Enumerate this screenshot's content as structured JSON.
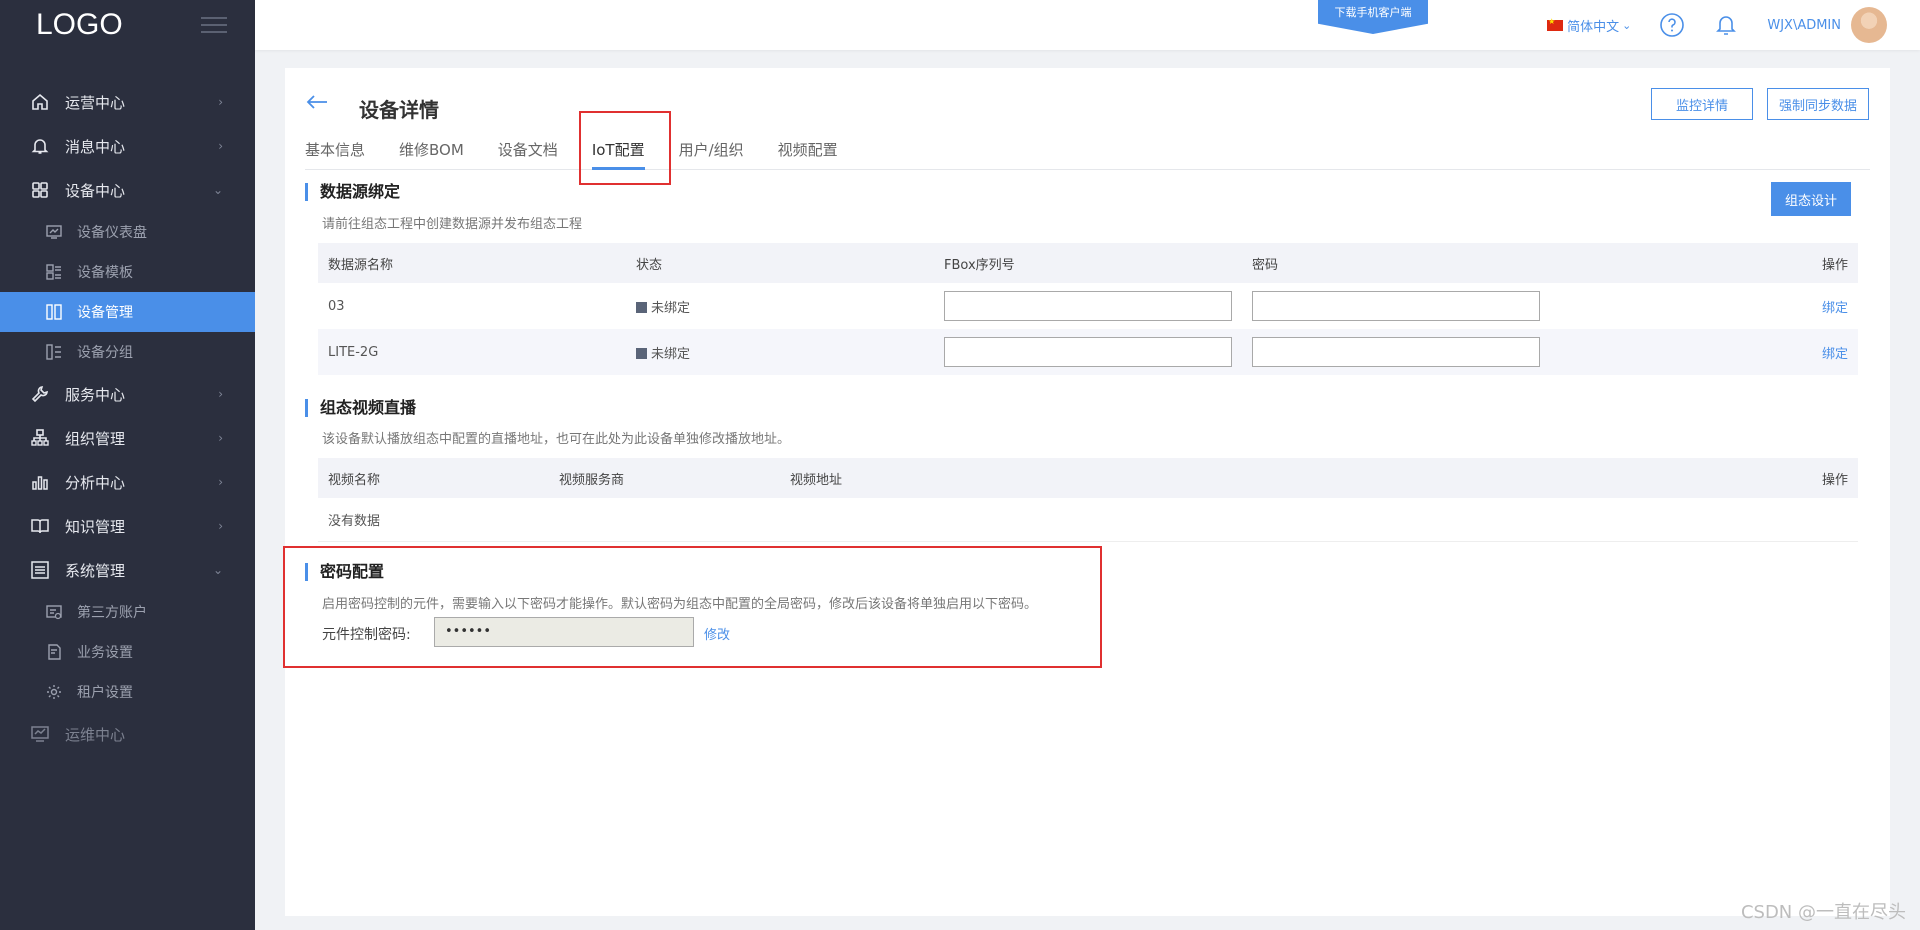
{
  "sidebar": {
    "logo": "LOGO",
    "items": [
      {
        "label": "运营中心",
        "arrow": "›"
      },
      {
        "label": "消息中心",
        "arrow": "›"
      },
      {
        "label": "设备中心",
        "arrow": "⌄"
      },
      {
        "label": "服务中心",
        "arrow": "›"
      },
      {
        "label": "组织管理",
        "arrow": "›"
      },
      {
        "label": "分析中心",
        "arrow": "›"
      },
      {
        "label": "知识管理",
        "arrow": "›"
      },
      {
        "label": "系统管理",
        "arrow": "⌄"
      },
      {
        "label": "运维中心"
      }
    ],
    "device_sub": [
      "设备仪表盘",
      "设备模板",
      "设备管理",
      "设备分组"
    ],
    "system_sub": [
      "第三方账户",
      "业务设置",
      "租户设置"
    ]
  },
  "header": {
    "download": "下载手机客户端",
    "language": "简体中文",
    "lang_arrow": "⌄",
    "username": "WJX\\ADMIN"
  },
  "page": {
    "title": "设备详情",
    "btn_monitor": "监控详情",
    "btn_sync": "强制同步数据",
    "tabs": [
      "基本信息",
      "维修BOM",
      "设备文档",
      "IoT配置",
      "用户/组织",
      "视频配置"
    ]
  },
  "datasource": {
    "title": "数据源绑定",
    "desc": "请前往组态工程中创建数据源并发布组态工程",
    "btn_design": "组态设计",
    "headers": [
      "数据源名称",
      "状态",
      "FBox序列号",
      "密码",
      "操作"
    ],
    "rows": [
      {
        "name": "03",
        "status": "未绑定",
        "fbox": "",
        "password": "",
        "action": "绑定"
      },
      {
        "name": "LITE-2G",
        "status": "未绑定",
        "fbox": "",
        "password": "",
        "action": "绑定"
      }
    ]
  },
  "video": {
    "title": "组态视频直播",
    "desc": "该设备默认播放组态中配置的直播地址，也可在此处为此设备单独修改播放地址。",
    "headers": [
      "视频名称",
      "视频服务商",
      "视频地址",
      "操作"
    ],
    "empty": "没有数据"
  },
  "password": {
    "title": "密码配置",
    "desc": "启用密码控制的元件，需要输入以下密码才能操作。默认密码为组态中配置的全局密码，修改后该设备将单独启用以下密码。",
    "label": "元件控制密码:",
    "value": "••••••",
    "modify": "修改"
  },
  "watermark": "CSDN @一直在尽头",
  "colors": {
    "accent": "#4a8fe8",
    "sidebar": "#2b2f3e",
    "highlight": "#e03030"
  }
}
